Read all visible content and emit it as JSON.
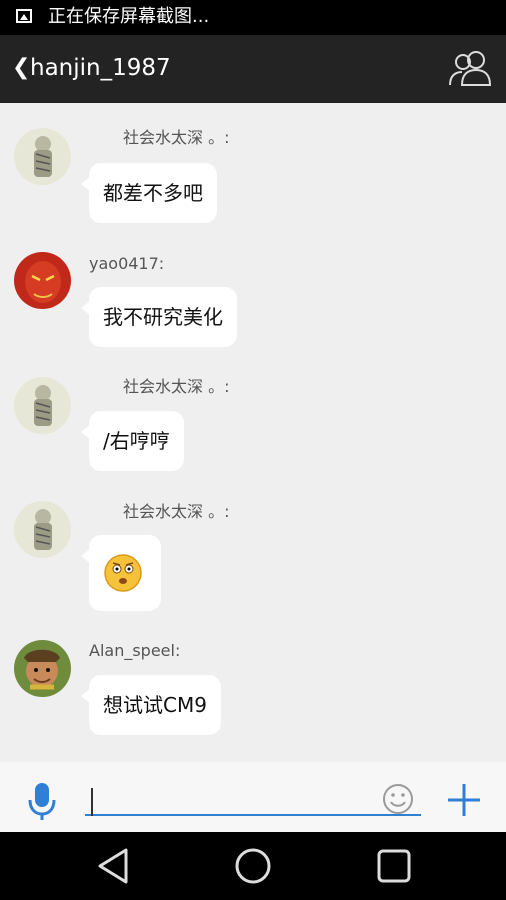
{
  "status_bar": {
    "text": "正在保存屏幕截图...",
    "icon": "image-icon"
  },
  "header": {
    "title": "hanjin_1987",
    "back_icon": "chevron-left-icon",
    "members_icon": "group-icon"
  },
  "messages": [
    {
      "sender": "社会水太深 。:",
      "text": "都差不多吧",
      "avatar": "avatar-sketch"
    },
    {
      "sender": "yao0417:",
      "text": "我不研究美化",
      "avatar": "avatar-red-mask"
    },
    {
      "sender": "社会水太深 。:",
      "text": "/右哼哼",
      "avatar": "avatar-sketch"
    },
    {
      "sender": "社会水太深 。:",
      "text": "",
      "emoji": "confused-face-emoji",
      "avatar": "avatar-sketch"
    },
    {
      "sender": "Alan_speel:",
      "text": "想试试CM9",
      "avatar": "avatar-scout-boy"
    }
  ],
  "input_bar": {
    "value": "",
    "placeholder": "",
    "icons": [
      "microphone-icon",
      "smiley-icon",
      "plus-icon"
    ]
  },
  "nav_bar": {
    "icons": [
      "back-triangle-icon",
      "home-circle-icon",
      "recent-square-icon"
    ]
  },
  "colors": {
    "header_bg": "#232323",
    "accent": "#2f7fd5",
    "bubble": "#ffffff",
    "chat_bg": "#efefef"
  }
}
